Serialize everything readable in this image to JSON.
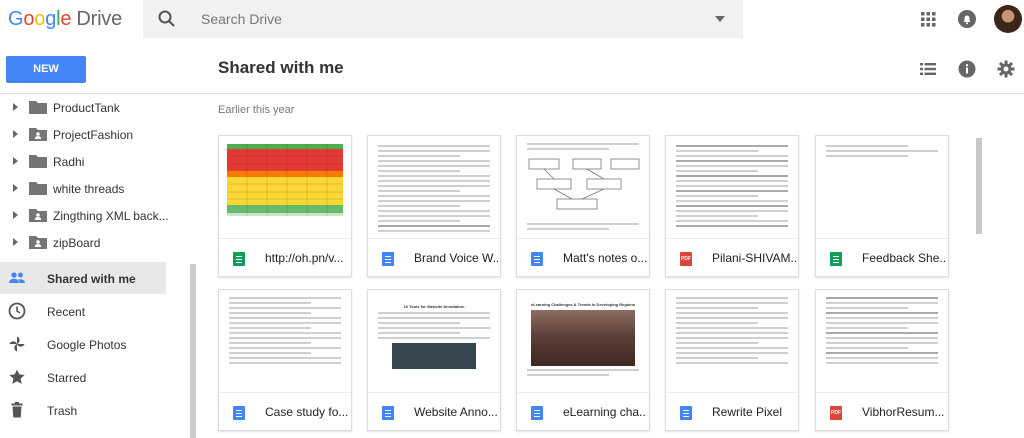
{
  "brand": {
    "google": "Google",
    "product": "Drive"
  },
  "search": {
    "placeholder": "Search Drive"
  },
  "toolbar": {
    "new_label": "NEW",
    "page_title": "Shared with me"
  },
  "sidebar": {
    "folders": [
      {
        "label": "ProductTank",
        "shared": false
      },
      {
        "label": "ProjectFashion",
        "shared": true
      },
      {
        "label": "Radhi",
        "shared": false
      },
      {
        "label": "white threads",
        "shared": false
      },
      {
        "label": "Zingthing XML back...",
        "shared": true
      },
      {
        "label": "zipBoard",
        "shared": true
      }
    ],
    "nav": [
      {
        "label": "Shared with me",
        "icon": "people-icon",
        "active": true
      },
      {
        "label": "Recent",
        "icon": "clock-icon",
        "active": false
      },
      {
        "label": "Google Photos",
        "icon": "pinwheel-icon",
        "active": false
      },
      {
        "label": "Starred",
        "icon": "star-icon",
        "active": false
      },
      {
        "label": "Trash",
        "icon": "trash-icon",
        "active": false
      }
    ]
  },
  "main": {
    "section_label": "Earlier this year",
    "files": [
      {
        "name": "http://oh.pn/v...",
        "type": "sheet"
      },
      {
        "name": "Brand Voice W...",
        "type": "doc"
      },
      {
        "name": "Matt's notes o...",
        "type": "doc"
      },
      {
        "name": "Pilani-SHIVAM...",
        "type": "pdf"
      },
      {
        "name": "Feedback She...",
        "type": "sheet"
      },
      {
        "name": "Case study fo...",
        "type": "doc"
      },
      {
        "name": "Website Anno...",
        "type": "doc"
      },
      {
        "name": "eLearning cha...",
        "type": "doc"
      },
      {
        "name": "Rewrite Pixel",
        "type": "doc"
      },
      {
        "name": "VibhorResum...",
        "type": "pdf"
      }
    ],
    "thumb_texts": {
      "website_title": "10 Tools for Website Annotation",
      "elearning_title": "eLearning Challenges & Trends In Developing Regions"
    }
  },
  "colors": {
    "accent": "#4285f4",
    "sheet": "#0f9d58",
    "pdf": "#db4437"
  },
  "pdf_label": "PDF"
}
